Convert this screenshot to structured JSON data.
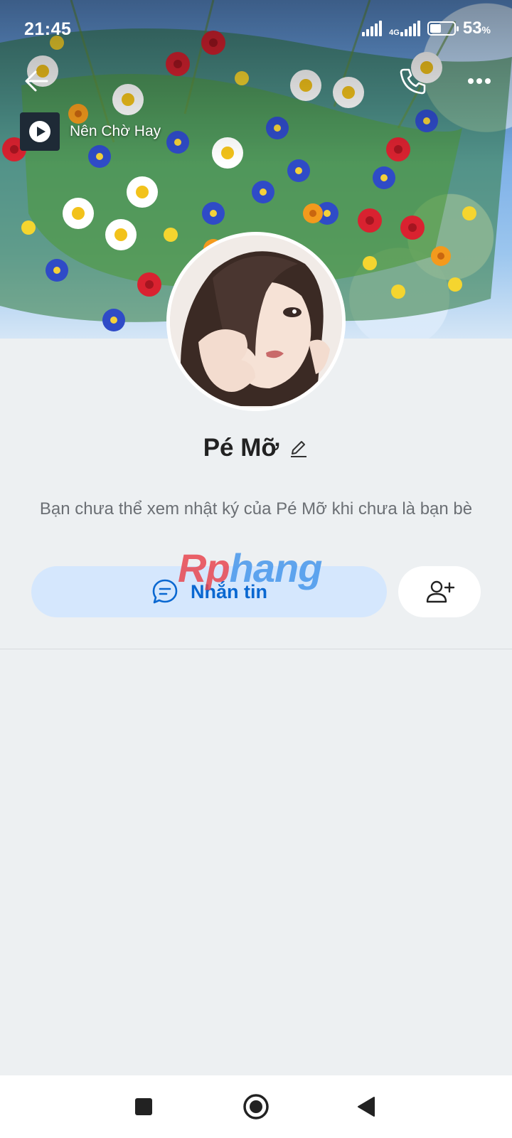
{
  "status_bar": {
    "time": "21:45",
    "network": "4G",
    "battery_percent": "53",
    "battery_unit": "%",
    "battery_level": 0.53
  },
  "nav": {
    "back_icon": "arrow-left-icon",
    "call_icon": "phone-icon",
    "more_icon": "more-horizontal-icon"
  },
  "music": {
    "title": "Nên Chờ Hay"
  },
  "profile": {
    "name": "Pé Mỡ",
    "notice": "Bạn chưa thể xem nhật ký của Pé Mỡ khi chưa là bạn bè"
  },
  "actions": {
    "message_label": "Nhắn tin",
    "message_icon": "chat-bubble-icon",
    "add_friend_icon": "add-user-icon"
  },
  "watermark": {
    "part1": "Rp",
    "part2": "hang"
  },
  "colors": {
    "accent": "#0a68d1",
    "button_bg": "#d5e7fd",
    "page_bg": "#edf0f2"
  }
}
